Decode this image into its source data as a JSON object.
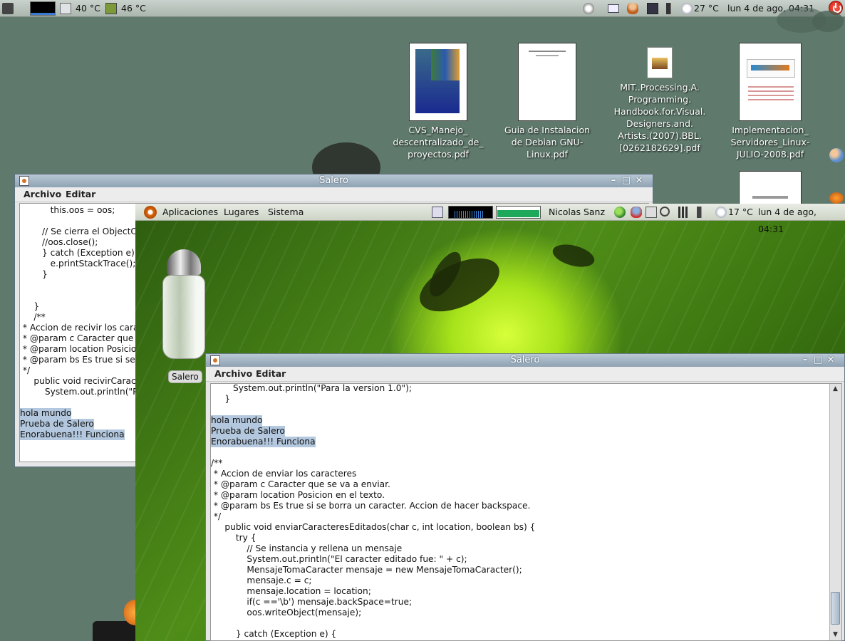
{
  "host_panel": {
    "temp_1": "40 °C",
    "temp_2": "46 °C",
    "weather_temp": "27 °C",
    "clock": "lun  4 de ago, 04:31"
  },
  "desktop_icons": [
    {
      "label": "CVS_Manejo_\ndescentralizado_de_\nproyectos.pdf"
    },
    {
      "label": "Guia de Instalacion\nde Debian GNU-\nLinux.pdf"
    },
    {
      "label": "MIT..Processing.A.\nProgramming.\nHandbook.for.Visual.\nDesigners.and.\nArtists.(2007).BBL.\n[0262182629].pdf"
    },
    {
      "label": "Implementacion_\nServidores_Linux-\nJULIO-2008.pdf"
    }
  ],
  "window_back": {
    "title": "Salero",
    "menu": [
      "Archivo",
      "Editar"
    ],
    "lines": [
      {
        "text": "           this.oos = oos;",
        "sel": false
      },
      {
        "text": "",
        "sel": false
      },
      {
        "text": "        // Se cierra el ObjectO",
        "sel": false
      },
      {
        "text": "        //oos.close();",
        "sel": false
      },
      {
        "text": "        } catch (Exception e) {",
        "sel": false
      },
      {
        "text": "           e.printStackTrace();",
        "sel": false
      },
      {
        "text": "        }",
        "sel": false
      },
      {
        "text": "",
        "sel": false
      },
      {
        "text": "",
        "sel": false
      },
      {
        "text": "     }",
        "sel": false
      },
      {
        "text": "     /**",
        "sel": false
      },
      {
        "text": " * Accion de recivir los carac",
        "sel": false
      },
      {
        "text": " * @param c Caracter que se",
        "sel": false
      },
      {
        "text": " * @param location Posicion",
        "sel": false
      },
      {
        "text": " * @param bs Es true si se b",
        "sel": false
      },
      {
        "text": " */",
        "sel": false
      },
      {
        "text": "     public void recivirCaracte",
        "sel": false
      },
      {
        "text": "         System.out.println(\"Par",
        "sel": false
      },
      {
        "text": "",
        "sel": false
      },
      {
        "text": "hola mundo",
        "sel": true
      },
      {
        "text": "Prueba de Salero",
        "sel": true
      },
      {
        "text": "Enorabuena!!! Funciona",
        "sel": true
      }
    ]
  },
  "guest_panel": {
    "menu_apps": "Aplicaciones",
    "menu_places": "Lugares",
    "menu_system": "Sistema",
    "user": "Nicolas Sanz",
    "weather_temp": "17 °C",
    "clock": "lun  4 de ago, 04:31"
  },
  "salero_icon": {
    "label": "Salero"
  },
  "window_front": {
    "title": "Salero",
    "menu": [
      "Archivo",
      "Editar"
    ],
    "lines": [
      {
        "text": "        System.out.println(\"Para la version 1.0\");",
        "sel": false
      },
      {
        "text": "     }",
        "sel": false
      },
      {
        "text": "",
        "sel": false
      },
      {
        "text": "hola mundo",
        "sel": true
      },
      {
        "text": "Prueba de Salero",
        "sel": true
      },
      {
        "text": "Enorabuena!!! Funciona",
        "sel": true
      },
      {
        "text": "",
        "sel": false
      },
      {
        "text": "/**",
        "sel": false
      },
      {
        "text": " * Accion de enviar los caracteres",
        "sel": false
      },
      {
        "text": " * @param c Caracter que se va a enviar.",
        "sel": false
      },
      {
        "text": " * @param location Posicion en el texto.",
        "sel": false
      },
      {
        "text": " * @param bs Es true si se borra un caracter. Accion de hacer backspace.",
        "sel": false
      },
      {
        "text": " */",
        "sel": false
      },
      {
        "text": "     public void enviarCaracteresEditados(char c, int location, boolean bs) {",
        "sel": false
      },
      {
        "text": "         try {",
        "sel": false
      },
      {
        "text": "             // Se instancia y rellena un mensaje",
        "sel": false
      },
      {
        "text": "             System.out.println(\"El caracter editado fue: \" + c);",
        "sel": false
      },
      {
        "text": "             MensajeTomaCaracter mensaje = new MensajeTomaCaracter();",
        "sel": false
      },
      {
        "text": "             mensaje.c = c;",
        "sel": false
      },
      {
        "text": "             mensaje.location = location;",
        "sel": false
      },
      {
        "text": "             if(c =='\\b') mensaje.backSpace=true;",
        "sel": false
      },
      {
        "text": "             oos.writeObject(mensaje);",
        "sel": false
      },
      {
        "text": "",
        "sel": false
      },
      {
        "text": "         } catch (Exception e) {",
        "sel": false
      }
    ]
  },
  "colors": {
    "host_desktop": "#5f7a6c",
    "selection": "#b3c8de",
    "titlebar": "#8fa3b4"
  }
}
